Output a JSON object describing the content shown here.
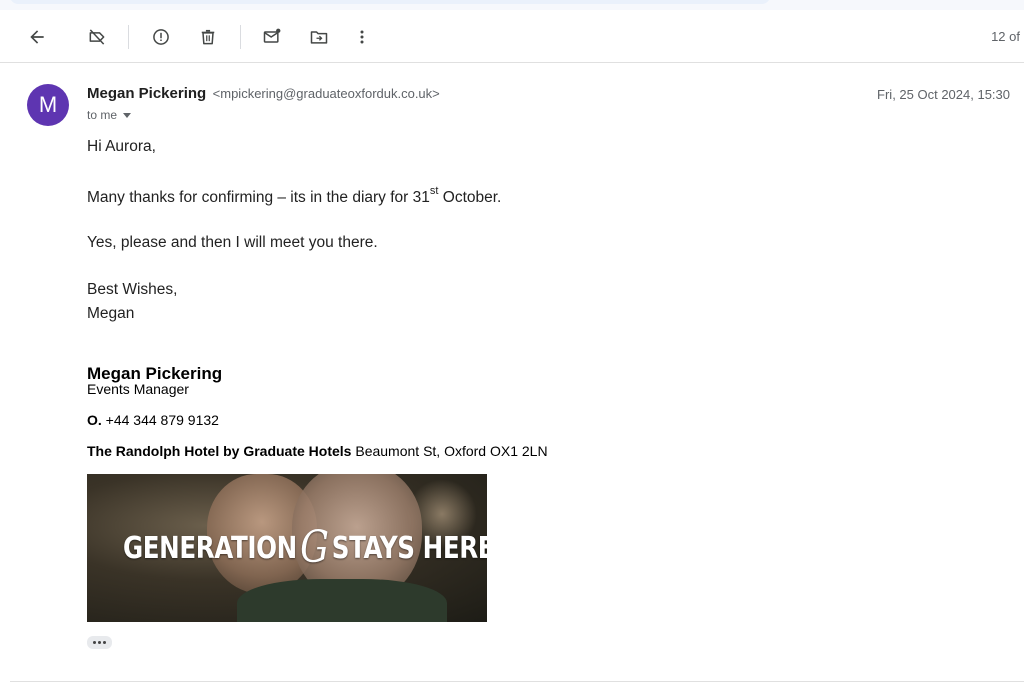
{
  "toolbar": {
    "icons": [
      "back-arrow-icon",
      "label-off-icon",
      "report-spam-icon",
      "delete-icon",
      "mark-unread-icon",
      "move-to-icon",
      "more-vert-icon"
    ],
    "counter": "12 of"
  },
  "message": {
    "avatar_letter": "M",
    "avatar_color": "#5e35b1",
    "sender_name": "Megan Pickering",
    "sender_email": "<mpickering@graduateoxforduk.co.uk>",
    "to_line": "to me",
    "timestamp": "Fri, 25 Oct 2024, 15:30",
    "greeting": "Hi Aurora,",
    "line1_before": "Many thanks for confirming – its in the diary for 31",
    "line1_sup": "st",
    "line1_after": " October.",
    "line2": "Yes, please and then I will meet you there.",
    "signoff": "Best Wishes,",
    "signoff_name": "Megan"
  },
  "signature": {
    "name": "Megan Pickering",
    "title": "Events Manager",
    "phone_label": "O.",
    "phone": " +44 344 879 9132",
    "hotel_name": "The Randolph Hotel by Graduate Hotels",
    "hotel_address": " Beaumont St, Oxford OX1 2LN",
    "banner_left": "GENERATION",
    "banner_logo": "G",
    "banner_right": "STAYS HERE"
  }
}
